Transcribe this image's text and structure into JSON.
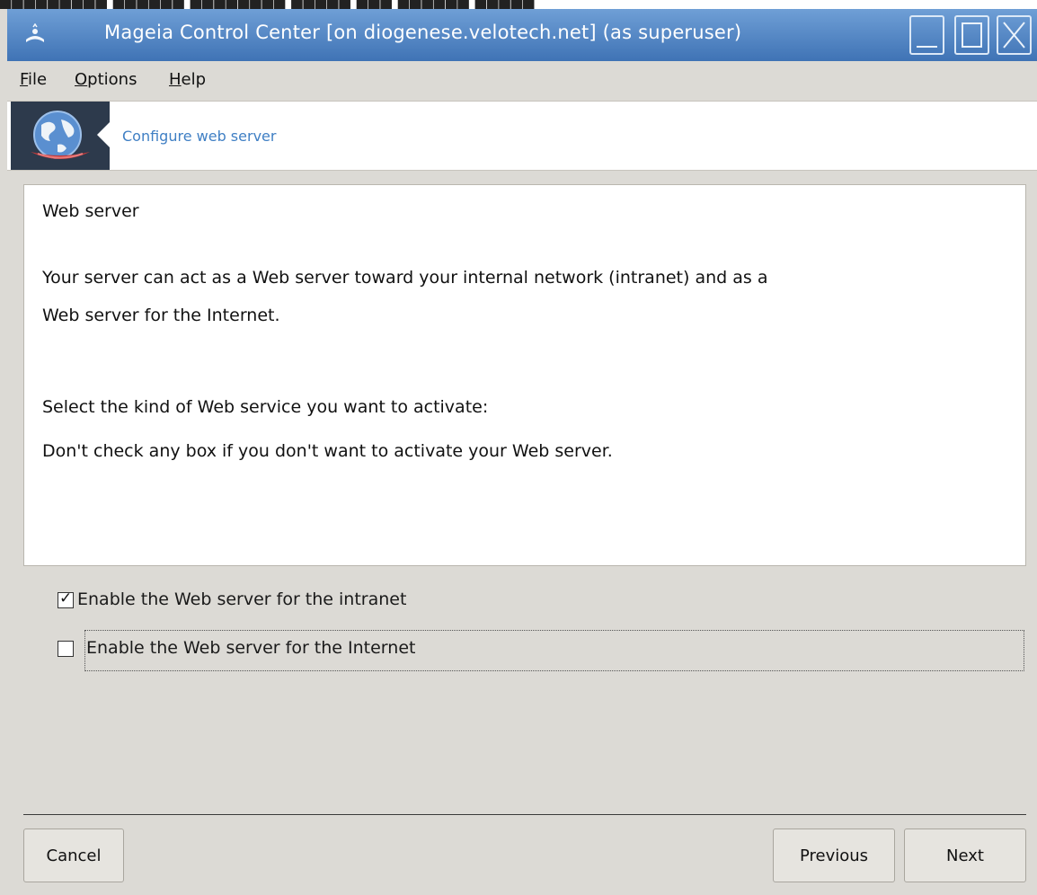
{
  "top_strip": {
    "text": "█████████ ██████ ████████ █████ ███ ██████ █████"
  },
  "window": {
    "title": "Mageia Control Center  [on diogenese.velotech.net] (as superuser)",
    "title_bar_color": "#4f85c6"
  },
  "menu": {
    "items": [
      {
        "accel": "F",
        "rest": "ile"
      },
      {
        "accel": "O",
        "rest": "ptions"
      },
      {
        "accel": "H",
        "rest": "elp"
      }
    ]
  },
  "banner": {
    "subtitle": "Configure web server",
    "subtitle_color": "#3f7fc4"
  },
  "content": {
    "heading": "Web server",
    "para1_line1": "Your server can act as a Web server toward your internal network (intranet) and as a",
    "para1_line2": "Web server for the Internet.",
    "para2": "Select the kind of Web service you want to activate:",
    "para3": "Don't check any box if you don't want to activate your Web server."
  },
  "options": [
    {
      "label": "Enable the Web server for the intranet",
      "checked": true
    },
    {
      "label": "Enable the Web server for the Internet",
      "checked": false,
      "focused": true
    }
  ],
  "buttons": {
    "cancel": "Cancel",
    "previous": "Previous",
    "next": "Next"
  }
}
